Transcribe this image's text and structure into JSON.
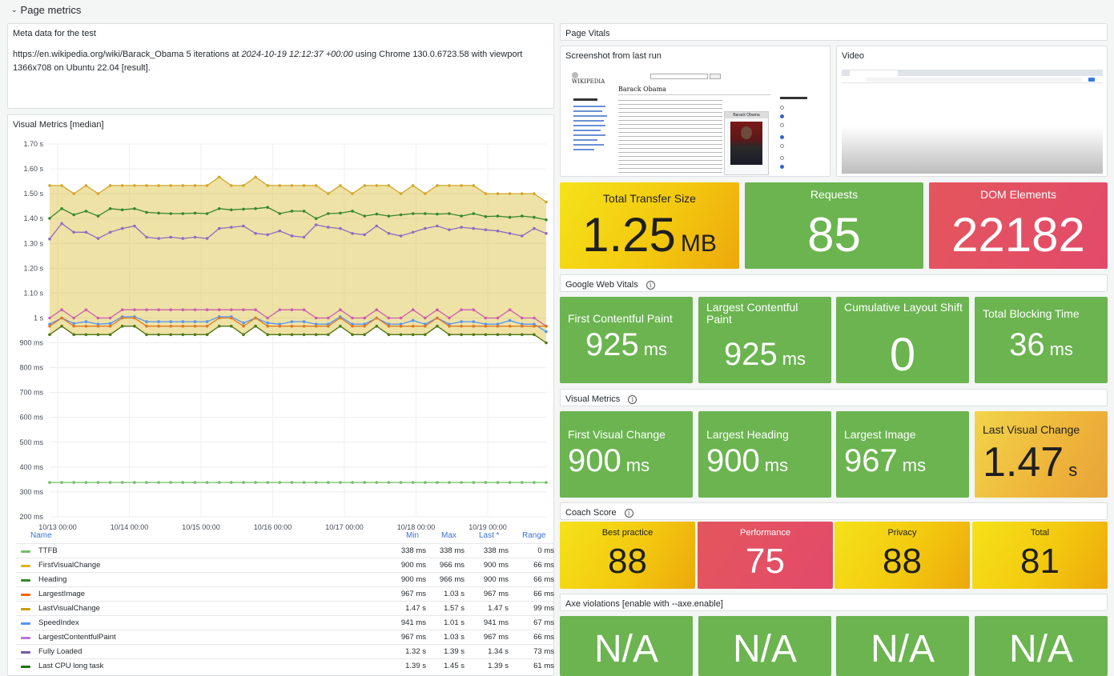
{
  "row_title": "Page metrics",
  "meta": {
    "title": "Meta data for the test",
    "url": "https://en.wikipedia.org/wiki/Barack_Obama",
    "iterations": "5 iterations at",
    "date": "2024-10-19 12:12:37 +00:00",
    "browser": "using Chrome 130.0.6723.58 with viewport",
    "viewport": "1366x708 on Ubuntu 22.04 [result]."
  },
  "vitals_title": "Page Vitals",
  "screenshot": {
    "title": "Screenshot from last run",
    "article_title": "Barack Obama",
    "infobox_title": "Barack Obama"
  },
  "video": {
    "title": "Video"
  },
  "top_stats": [
    {
      "label": "Total Transfer Size",
      "value": "1.25",
      "unit": "MB"
    },
    {
      "label": "Requests",
      "value": "85"
    },
    {
      "label": "DOM Elements",
      "value": "22182"
    }
  ],
  "gwv": {
    "title": "Google Web Vitals",
    "items": [
      {
        "label": "First Contentful Paint",
        "value": "925",
        "unit": "ms"
      },
      {
        "label": "Largest Contentful Paint",
        "value": "925",
        "unit": "ms"
      },
      {
        "label": "Cumulative Layout Shift",
        "value": "0"
      },
      {
        "label": "Total Blocking Time",
        "value": "36",
        "unit": "ms"
      }
    ]
  },
  "vm": {
    "title": "Visual Metrics",
    "items": [
      {
        "label": "First Visual Change",
        "value": "900",
        "unit": "ms"
      },
      {
        "label": "Largest Heading",
        "value": "900",
        "unit": "ms"
      },
      {
        "label": "Largest Image",
        "value": "967",
        "unit": "ms"
      },
      {
        "label": "Last Visual Change",
        "value": "1.47",
        "unit": "s"
      }
    ]
  },
  "coach": {
    "title": "Coach Score",
    "items": [
      {
        "label": "Best practice",
        "value": "88"
      },
      {
        "label": "Performance",
        "value": "75"
      },
      {
        "label": "Privacy",
        "value": "88"
      },
      {
        "label": "Total",
        "value": "81"
      }
    ]
  },
  "axe": {
    "title": "Axe violations [enable with --axe.enable]",
    "items": [
      "N/A",
      "N/A",
      "N/A",
      "N/A"
    ]
  },
  "visual_panel_title": "Visual Metrics [median]",
  "legend": {
    "headers": {
      "name": "Name",
      "min": "Min",
      "max": "Max",
      "last": "Last *",
      "range": "Range"
    },
    "rows": [
      {
        "name": "TTFB",
        "color": "#73bf69",
        "min": "338 ms",
        "max": "338 ms",
        "last": "338 ms",
        "range": "0 ms"
      },
      {
        "name": "FirstVisualChange",
        "color": "#e0b400",
        "min": "900 ms",
        "max": "966 ms",
        "last": "900 ms",
        "range": "66 ms"
      },
      {
        "name": "Heading",
        "color": "#37872d",
        "min": "900 ms",
        "max": "966 ms",
        "last": "900 ms",
        "range": "66 ms"
      },
      {
        "name": "LargestImage",
        "color": "#fa6400",
        "min": "967 ms",
        "max": "1.03 s",
        "last": "967 ms",
        "range": "66 ms"
      },
      {
        "name": "LastVisualChange",
        "color": "#c4a000",
        "min": "1.47 s",
        "max": "1.57 s",
        "last": "1.47 s",
        "range": "99 ms"
      },
      {
        "name": "SpeedIndex",
        "color": "#5794f2",
        "min": "941 ms",
        "max": "1.01 s",
        "last": "941 ms",
        "range": "67 ms"
      },
      {
        "name": "LargestContentfulPaint",
        "color": "#b877d9",
        "min": "967 ms",
        "max": "1.03 s",
        "last": "967 ms",
        "range": "66 ms"
      },
      {
        "name": "Fully Loaded",
        "color": "#705da0",
        "min": "1.32 s",
        "max": "1.39 s",
        "last": "1.34 s",
        "range": "73 ms"
      },
      {
        "name": "Last CPU long task",
        "color": "#19730e",
        "min": "1.39 s",
        "max": "1.45 s",
        "last": "1.39 s",
        "range": "61 ms"
      }
    ]
  },
  "chart_data": {
    "type": "line",
    "ylim": [
      200,
      1700
    ],
    "yticks": [
      "1.70 s",
      "1.60 s",
      "1.50 s",
      "1.40 s",
      "1.30 s",
      "1.20 s",
      "1.10 s",
      "1 s",
      "900 ms",
      "800 ms",
      "700 ms",
      "600 ms",
      "500 ms",
      "400 ms",
      "300 ms",
      "200 ms"
    ],
    "ytick_values": [
      1700,
      1600,
      1500,
      1400,
      1300,
      1200,
      1100,
      1000,
      900,
      800,
      700,
      600,
      500,
      400,
      300,
      200
    ],
    "xticks": [
      "10/13 00:00",
      "10/14 00:00",
      "10/15 00:00",
      "10/16 00:00",
      "10/17 00:00",
      "10/18 00:00",
      "10/19 00:00"
    ],
    "series": [
      {
        "name": "LastVisualChange",
        "color": "#d4a72c",
        "fill": true,
        "values": [
          1533,
          1533,
          1500,
          1533,
          1500,
          1533,
          1533,
          1533,
          1533,
          1533,
          1533,
          1533,
          1533,
          1533,
          1567,
          1533,
          1533,
          1567,
          1533,
          1533,
          1533,
          1533,
          1533,
          1500,
          1533,
          1500,
          1533,
          1533,
          1533,
          1500,
          1533,
          1500,
          1533,
          1533,
          1533,
          1533,
          1500,
          1500,
          1500,
          1500,
          1500,
          1467
        ]
      },
      {
        "name": "Last CPU long task",
        "color": "#37872d",
        "values": [
          1401,
          1440,
          1415,
          1430,
          1410,
          1440,
          1435,
          1440,
          1425,
          1422,
          1420,
          1420,
          1422,
          1420,
          1440,
          1435,
          1438,
          1440,
          1445,
          1420,
          1430,
          1430,
          1400,
          1420,
          1422,
          1430,
          1410,
          1418,
          1410,
          1415,
          1420,
          1420,
          1418,
          1420,
          1410,
          1420,
          1408,
          1410,
          1405,
          1410,
          1405,
          1395
        ]
      },
      {
        "name": "Fully Loaded",
        "color": "#8f6bc4",
        "values": [
          1318,
          1380,
          1345,
          1345,
          1320,
          1345,
          1360,
          1370,
          1325,
          1320,
          1325,
          1320,
          1325,
          1320,
          1360,
          1365,
          1370,
          1340,
          1335,
          1350,
          1330,
          1325,
          1375,
          1365,
          1360,
          1340,
          1335,
          1370,
          1340,
          1330,
          1345,
          1360,
          1370,
          1355,
          1365,
          1360,
          1355,
          1350,
          1340,
          1330,
          1360,
          1340
        ]
      },
      {
        "name": "LargestContentfulPaint",
        "color": "#cc5fae",
        "values": [
          1000,
          1033,
          1000,
          1033,
          1000,
          1000,
          1033,
          1033,
          1033,
          1033,
          1033,
          1033,
          1033,
          1033,
          1033,
          1033,
          1033,
          1033,
          1000,
          1033,
          1033,
          1033,
          1000,
          1000,
          1033,
          1000,
          1000,
          1033,
          1000,
          1000,
          1033,
          1000,
          1033,
          1000,
          1033,
          1033,
          1000,
          1000,
          1033,
          1000,
          1000,
          967
        ]
      },
      {
        "name": "SpeedIndex",
        "color": "#5794f2",
        "values": [
          975,
          1000,
          978,
          985,
          975,
          978,
          1005,
          1005,
          985,
          985,
          985,
          985,
          985,
          985,
          1005,
          1005,
          980,
          1000,
          980,
          975,
          985,
          985,
          975,
          975,
          1005,
          975,
          975,
          1000,
          975,
          975,
          990,
          975,
          1000,
          975,
          985,
          985,
          975,
          975,
          990,
          975,
          975,
          945
        ]
      },
      {
        "name": "LargestImage",
        "color": "#e07a20",
        "values": [
          967,
          1000,
          967,
          967,
          967,
          967,
          1000,
          1000,
          967,
          967,
          967,
          967,
          967,
          967,
          1000,
          1000,
          967,
          1000,
          967,
          967,
          967,
          967,
          967,
          967,
          1000,
          967,
          967,
          1000,
          967,
          967,
          967,
          967,
          1000,
          967,
          967,
          967,
          967,
          967,
          967,
          967,
          967,
          967
        ]
      },
      {
        "name": "FirstVisualChange",
        "color": "#e0b400",
        "values": [
          933,
          967,
          933,
          933,
          933,
          933,
          967,
          967,
          933,
          933,
          933,
          933,
          933,
          933,
          967,
          967,
          933,
          967,
          933,
          933,
          933,
          933,
          933,
          933,
          967,
          933,
          933,
          967,
          933,
          933,
          933,
          933,
          967,
          933,
          933,
          933,
          933,
          933,
          933,
          933,
          933,
          900
        ]
      },
      {
        "name": "Heading",
        "color": "#4f7a1f",
        "values": [
          933,
          967,
          933,
          933,
          933,
          933,
          967,
          967,
          933,
          933,
          933,
          933,
          933,
          933,
          967,
          967,
          933,
          967,
          933,
          933,
          933,
          933,
          933,
          933,
          967,
          933,
          933,
          967,
          933,
          933,
          933,
          933,
          967,
          933,
          933,
          933,
          933,
          933,
          933,
          933,
          933,
          900
        ]
      },
      {
        "name": "TTFB",
        "color": "#73bf69",
        "values": [
          338,
          338,
          338,
          338,
          338,
          338,
          338,
          338,
          338,
          338,
          338,
          338,
          338,
          338,
          338,
          338,
          338,
          338,
          338,
          338,
          338,
          338,
          338,
          338,
          338,
          338,
          338,
          338,
          338,
          338,
          338,
          338,
          338,
          338,
          338,
          338,
          338,
          338,
          338,
          338,
          338,
          338
        ]
      }
    ]
  }
}
